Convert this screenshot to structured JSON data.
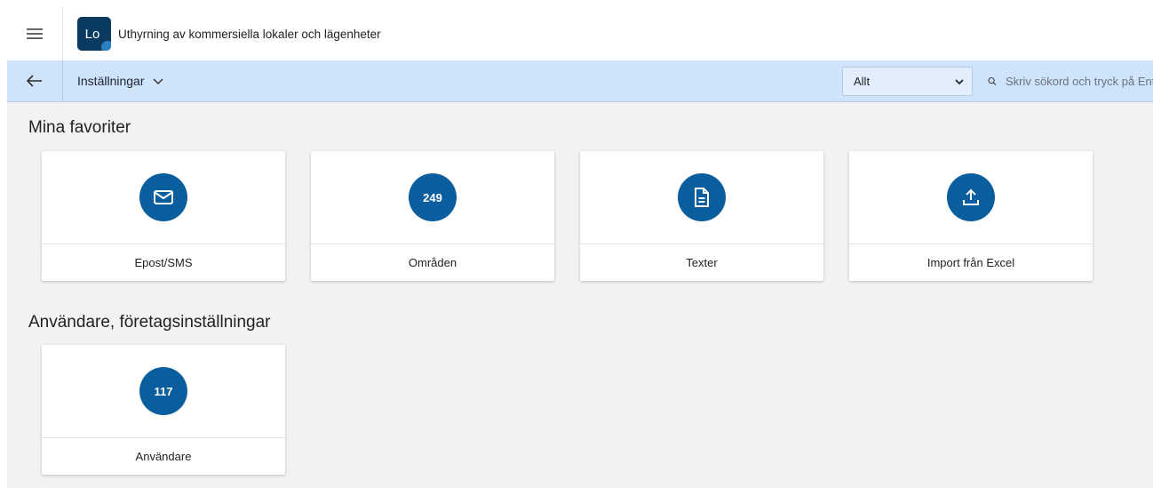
{
  "header": {
    "menu_icon": "hamburger-menu-icon",
    "logo_text": "Lo",
    "app_title": "Uthyrning av kommersiella lokaler och lägenheter"
  },
  "subheader": {
    "back_icon": "arrow-left-icon",
    "section_label": "Inställningar",
    "filter_selected": "Allt",
    "search_placeholder": "Skriv sökord och tryck på Enter"
  },
  "sections": [
    {
      "title": "Mina favoriter",
      "tiles": [
        {
          "label": "Epost/SMS",
          "icon": "envelope-icon",
          "badge": null
        },
        {
          "label": "Områden",
          "icon": null,
          "badge": "249"
        },
        {
          "label": "Texter",
          "icon": "document-icon",
          "badge": null
        },
        {
          "label": "Import från Excel",
          "icon": "upload-icon",
          "badge": null
        }
      ]
    },
    {
      "title": "Användare, företagsinställningar",
      "tiles": [
        {
          "label": "Användare",
          "icon": null,
          "badge": "117"
        }
      ]
    }
  ],
  "colors": {
    "accent": "#0b5e9e",
    "subheader_bg": "#cfe3fb",
    "page_bg": "#f1f2f3",
    "logo_bg": "#0a3a5f"
  }
}
